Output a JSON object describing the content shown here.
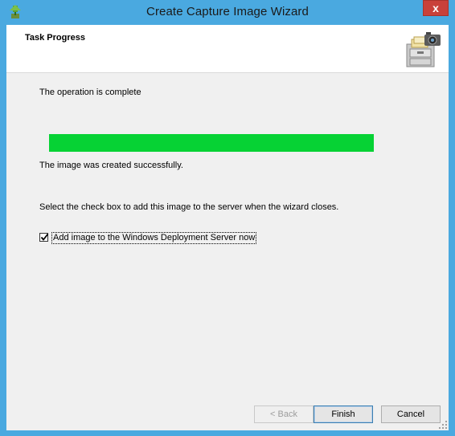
{
  "window": {
    "title": "Create Capture Image Wizard",
    "close_label": "x"
  },
  "header": {
    "title": "Task Progress"
  },
  "body": {
    "status_text": "The operation is complete",
    "progress_value": 1.0,
    "progress_color": "#06d234",
    "result_text": "The image was created successfully.",
    "instruction_text": "Select the check box to add this image to the server when the wizard closes.",
    "checkbox": {
      "label": "Add image to the Windows Deployment Server now",
      "checked": true
    }
  },
  "buttons": {
    "back": "< Back",
    "finish": "Finish",
    "cancel": "Cancel"
  },
  "colors": {
    "title_bar": "#4aa9e0",
    "close_button": "#c9413a"
  }
}
